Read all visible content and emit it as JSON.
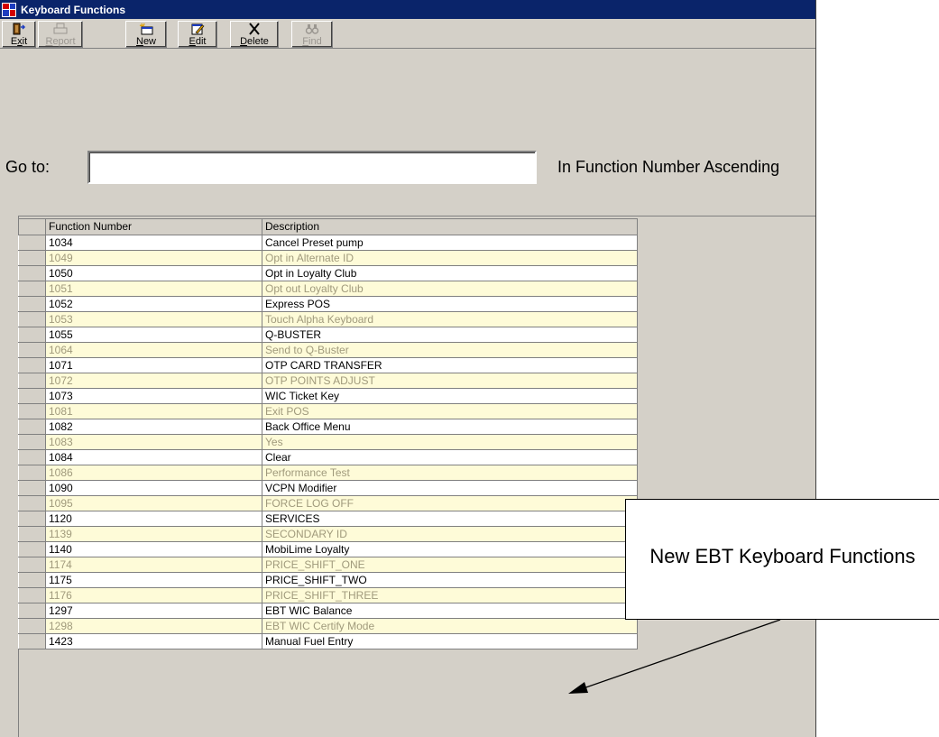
{
  "window": {
    "title": "Keyboard Functions"
  },
  "toolbar": {
    "buttons": [
      {
        "icon": "exit-door-icon",
        "label": "Exit",
        "mnemonic": "x",
        "enabled": true
      },
      {
        "icon": "printer-icon",
        "label": "Report",
        "mnemonic": "R",
        "enabled": false
      },
      {
        "icon": "new-record-icon",
        "label": "New",
        "mnemonic": "N",
        "enabled": true
      },
      {
        "icon": "edit-icon",
        "label": "Edit",
        "mnemonic": "E",
        "enabled": true
      },
      {
        "icon": "delete-x-icon",
        "label": "Delete",
        "mnemonic": "D",
        "enabled": true
      },
      {
        "icon": "binoculars-icon",
        "label": "Find",
        "mnemonic": "F",
        "enabled": false
      }
    ]
  },
  "goto": {
    "label": "Go to:",
    "value": "",
    "sort_label": "In Function Number Ascending"
  },
  "grid": {
    "columns": [
      "Function Number",
      "Description"
    ],
    "rows": [
      {
        "number": "1034",
        "description": "Cancel Preset pump"
      },
      {
        "number": "1049",
        "description": "Opt in Alternate ID"
      },
      {
        "number": "1050",
        "description": "Opt in Loyalty Club"
      },
      {
        "number": "1051",
        "description": "Opt out Loyalty Club"
      },
      {
        "number": "1052",
        "description": "Express POS"
      },
      {
        "number": "1053",
        "description": "Touch Alpha Keyboard"
      },
      {
        "number": "1055",
        "description": "Q-BUSTER"
      },
      {
        "number": "1064",
        "description": "Send to Q-Buster"
      },
      {
        "number": "1071",
        "description": "OTP CARD TRANSFER"
      },
      {
        "number": "1072",
        "description": "OTP POINTS ADJUST"
      },
      {
        "number": "1073",
        "description": "WIC Ticket Key"
      },
      {
        "number": "1081",
        "description": "Exit POS"
      },
      {
        "number": "1082",
        "description": "Back Office Menu"
      },
      {
        "number": "1083",
        "description": "Yes"
      },
      {
        "number": "1084",
        "description": "Clear"
      },
      {
        "number": "1086",
        "description": "Performance Test"
      },
      {
        "number": "1090",
        "description": "VCPN Modifier"
      },
      {
        "number": "1095",
        "description": "FORCE LOG OFF"
      },
      {
        "number": "1120",
        "description": "SERVICES"
      },
      {
        "number": "1139",
        "description": "SECONDARY ID"
      },
      {
        "number": "1140",
        "description": "MobiLime Loyalty"
      },
      {
        "number": "1174",
        "description": "PRICE_SHIFT_ONE"
      },
      {
        "number": "1175",
        "description": "PRICE_SHIFT_TWO"
      },
      {
        "number": "1176",
        "description": "PRICE_SHIFT_THREE"
      },
      {
        "number": "1297",
        "description": "EBT WIC Balance"
      },
      {
        "number": "1298",
        "description": "EBT WIC Certify Mode"
      },
      {
        "number": "1423",
        "description": "Manual Fuel Entry"
      }
    ]
  },
  "callout": {
    "text": "New EBT Keyboard Functions"
  },
  "colors": {
    "titlebar": "#0a246a",
    "window_bg": "#d4d0c8",
    "row_alt_bg": "#fefbd8",
    "row_alt_text": "#a09a7c"
  }
}
